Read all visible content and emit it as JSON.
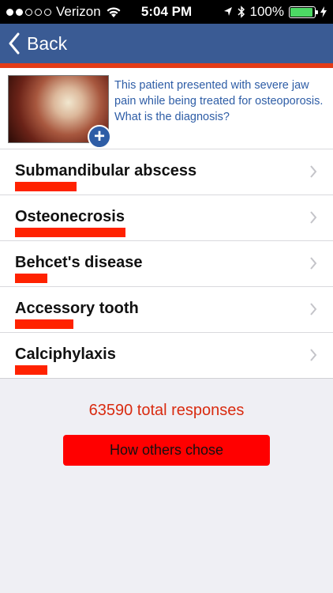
{
  "status_bar": {
    "carrier": "Verizon",
    "time": "5:04 PM",
    "battery": "100%"
  },
  "nav": {
    "back_label": "Back",
    "accent_color": "#e33b16",
    "bar_color": "#3a5b94"
  },
  "question": {
    "text": "This patient presented with severe jaw pain while being treated for osteoporosis. What is the diagnosis?",
    "image_icon": "plus-circle-icon"
  },
  "answers": [
    {
      "label": "Submandibular abscess",
      "share": 0.19
    },
    {
      "label": "Osteonecrosis",
      "share": 0.34
    },
    {
      "label": "Behcet's disease",
      "share": 0.1
    },
    {
      "label": "Accessory tooth",
      "share": 0.18
    },
    {
      "label": "Calciphylaxis",
      "share": 0.1
    }
  ],
  "responses": {
    "text": "63590 total responses",
    "button_label": "How others chose"
  }
}
